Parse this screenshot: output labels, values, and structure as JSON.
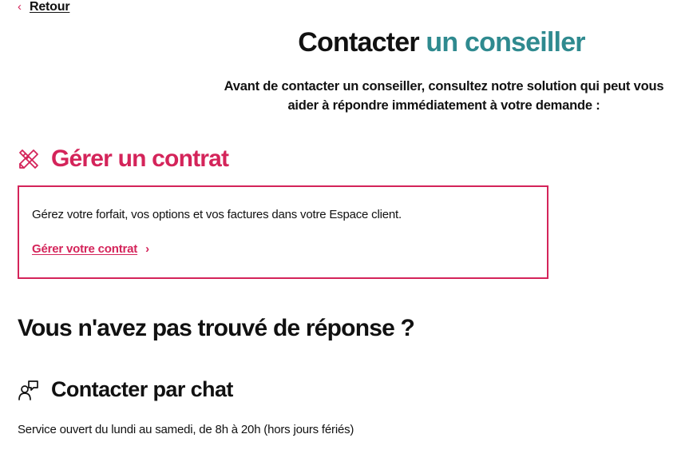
{
  "nav": {
    "back_chevron": "‹",
    "back_label": "Retour"
  },
  "header": {
    "title_part1": "Contacter",
    "title_part2": "un conseiller",
    "intro_line1": "Avant de contacter un conseiller, consultez notre solution qui peut vous",
    "intro_line2": "aider à répondre immédiatement à votre demande :"
  },
  "contract_section": {
    "icon": "tools-icon",
    "heading": "Gérer un contrat",
    "card_text": "Gérez votre forfait, vos options et vos factures dans votre Espace client.",
    "link_label": "Gérer votre contrat",
    "link_chevron": "›"
  },
  "fallback": {
    "heading": "Vous n'avez pas trouvé de réponse ?"
  },
  "chat_section": {
    "icon": "chat-icon",
    "heading": "Contacter par chat",
    "hours": "Service ouvert du lundi au samedi, de 8h à 20h (hors jours fériés)"
  },
  "colors": {
    "accent_pink": "#d4245a",
    "accent_teal": "#2f8a8f",
    "text": "#111111"
  }
}
